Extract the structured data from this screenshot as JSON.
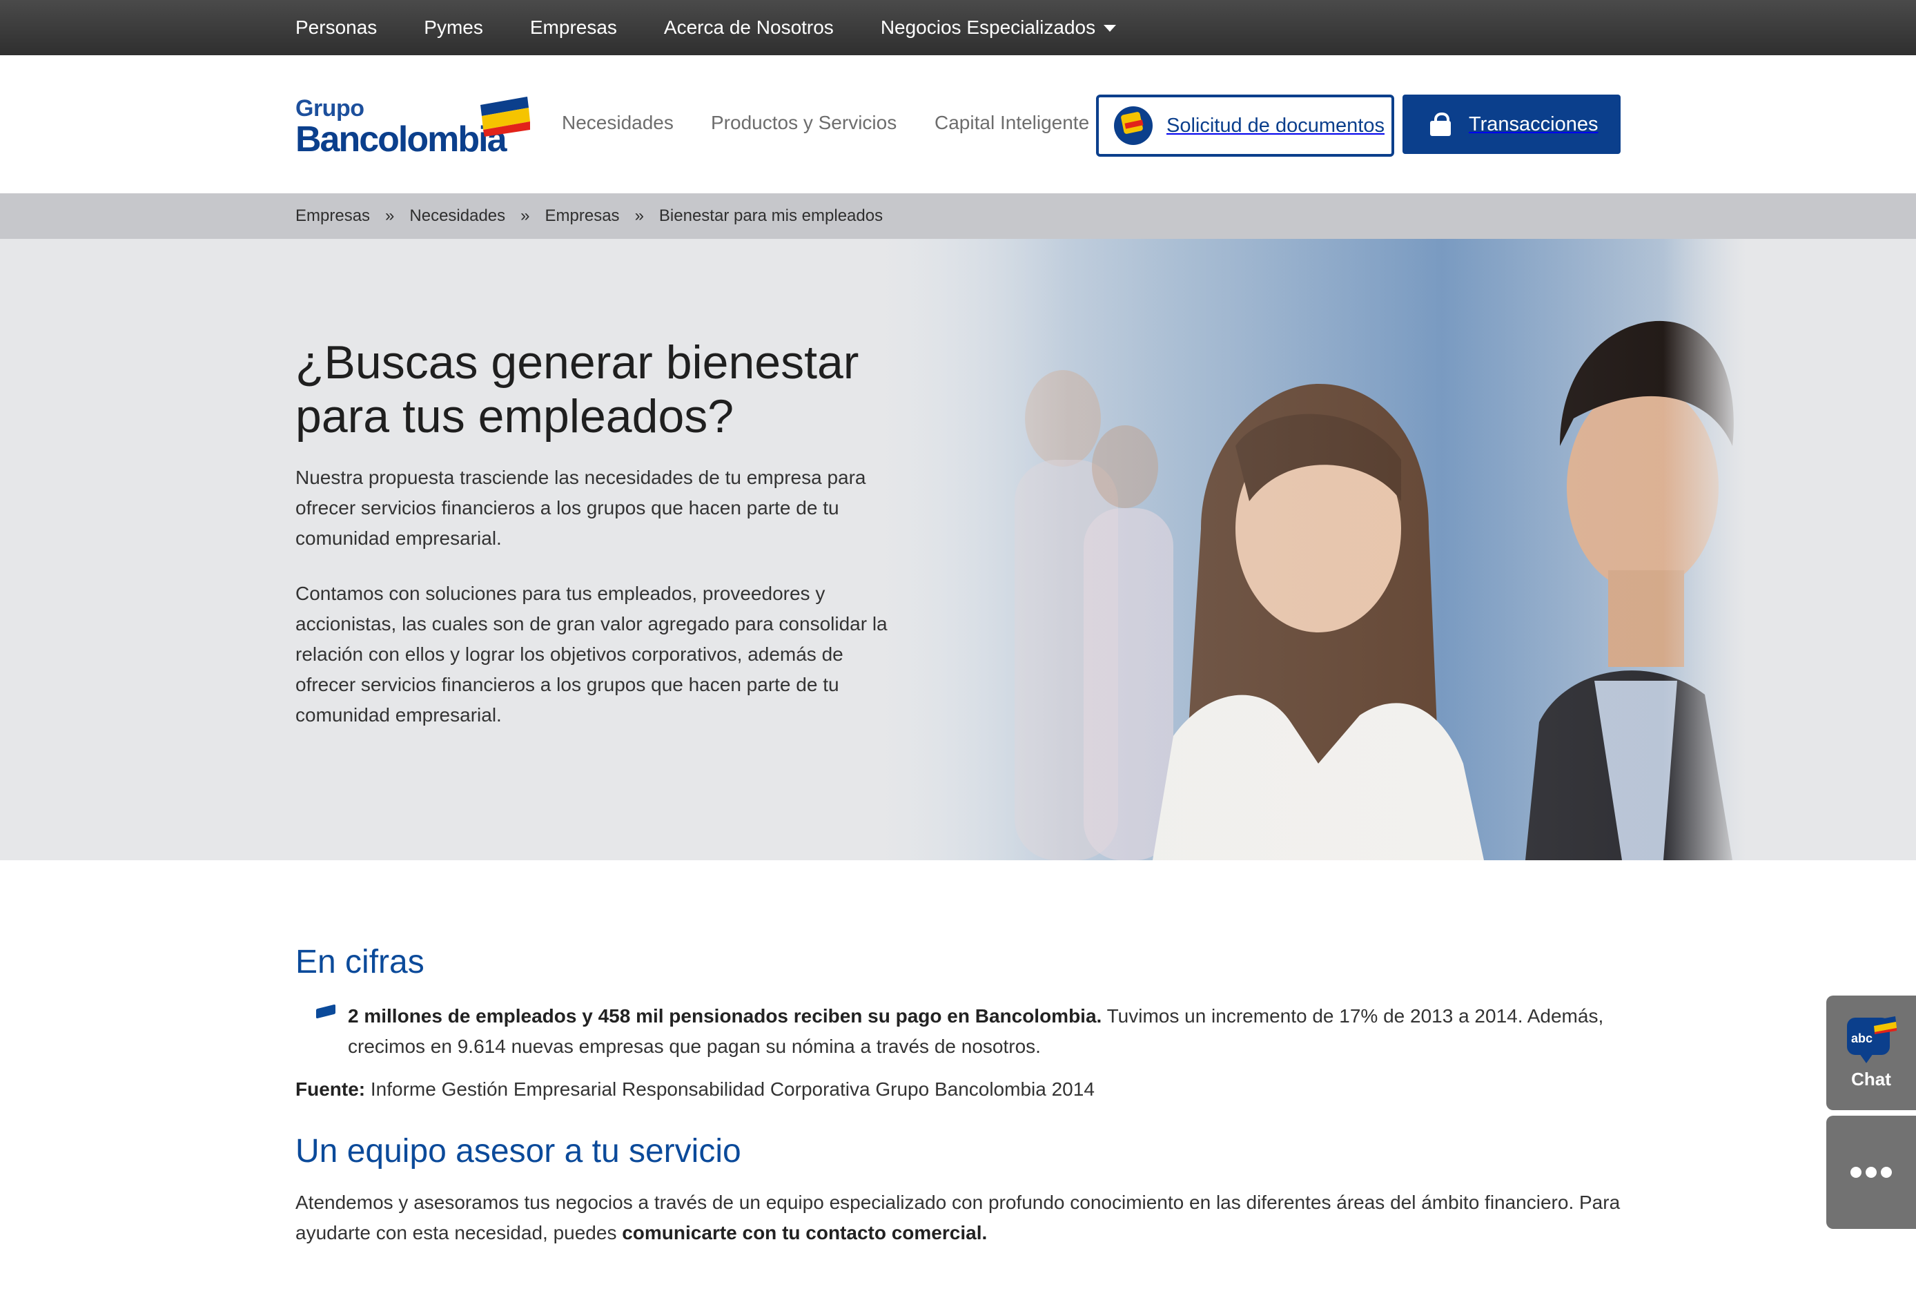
{
  "topbar": {
    "items": [
      "Personas",
      "Pymes",
      "Empresas",
      "Acerca de Nosotros",
      "Negocios Especializados"
    ]
  },
  "header": {
    "logo_line1": "Grupo",
    "logo_line2": "Bancolombia",
    "nav": [
      "Necesidades",
      "Productos y Servicios",
      "Capital Inteligente"
    ],
    "docs_button": "Solicitud de documentos",
    "transactions_button": "Transacciones"
  },
  "breadcrumb": {
    "items": [
      "Empresas",
      "Necesidades",
      "Empresas",
      "Bienestar para mis empleados"
    ],
    "separator": "»"
  },
  "hero": {
    "title": "¿Buscas generar bienestar para tus empleados?",
    "paragraph1": "Nuestra propuesta trasciende las necesidades de tu empresa para ofrecer servicios financieros a los grupos que hacen parte de tu comunidad empresarial.",
    "paragraph2": "Contamos con soluciones para tus empleados, proveedores y accionistas, las cuales son de gran valor agregado para consolidar la relación con ellos y lograr los objetivos corporativos, además de ofrecer servicios financieros a los grupos que hacen parte de tu comunidad empresarial."
  },
  "cifras": {
    "title": "En cifras",
    "bullet_bold": "2 millones de empleados y 458 mil pensionados reciben su pago en Bancolombia.",
    "bullet_rest": " Tuvimos un incremento de 17% de 2013 a 2014. Además, crecimos en 9.614 nuevas empresas que pagan su nómina a través de nosotros.",
    "source_label": "Fuente:",
    "source_text": " Informe Gestión Empresarial Responsabilidad Corporativa Grupo Bancolombia 2014"
  },
  "equipo": {
    "title": "Un equipo asesor a tu servicio",
    "text": "Atendemos y asesoramos tus negocios a través de un equipo especializado con profundo conocimiento en las diferentes áreas del ámbito financiero. Para ayudarte con esta necesidad, puedes ",
    "text_bold": "comunicarte con tu contacto comercial."
  },
  "side_widgets": {
    "chat_badge": "abc",
    "chat_label": "Chat"
  },
  "colors": {
    "brand_blue": "#0b3f8c",
    "heading_blue": "#0b4a9a",
    "topbar": "#3a3a3a",
    "breadcrumb_bg": "#c6c7cb",
    "hero_bg": "#e6e7e9",
    "flag_yellow": "#f5c400",
    "flag_red": "#e2231a"
  },
  "icons": [
    "caret-down-icon",
    "bancolombia-flag-icon",
    "document-request-icon",
    "lock-icon",
    "bullet-flag-icon",
    "chat-icon",
    "more-options-icon"
  ]
}
